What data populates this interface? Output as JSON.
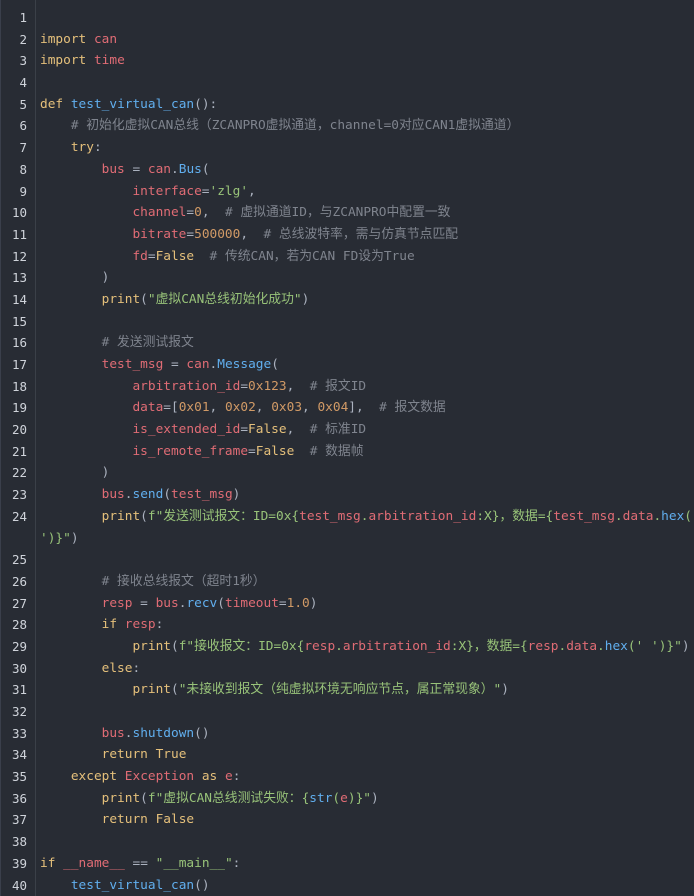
{
  "colors": {
    "background": "#282c34",
    "keyword": "#e5c07b",
    "function": "#61afef",
    "string": "#98c379",
    "number": "#d19a66",
    "identifier": "#e06c75",
    "comment": "#7f848e",
    "line_number": "#cfd3da"
  },
  "lines": [
    {
      "n": "1",
      "tokens": []
    },
    {
      "n": "2",
      "tokens": [
        {
          "t": "kw",
          "v": "import"
        },
        {
          "t": "plain",
          "v": " "
        },
        {
          "t": "id",
          "v": "can"
        }
      ]
    },
    {
      "n": "3",
      "tokens": [
        {
          "t": "kw",
          "v": "import"
        },
        {
          "t": "plain",
          "v": " "
        },
        {
          "t": "id",
          "v": "time"
        }
      ]
    },
    {
      "n": "4",
      "tokens": []
    },
    {
      "n": "5",
      "tokens": [
        {
          "t": "kw",
          "v": "def"
        },
        {
          "t": "plain",
          "v": " "
        },
        {
          "t": "fn",
          "v": "test_virtual_can"
        },
        {
          "t": "plain",
          "v": "():"
        }
      ]
    },
    {
      "n": "6",
      "tokens": [
        {
          "t": "plain",
          "v": "    "
        },
        {
          "t": "com",
          "v": "# 初始化虚拟CAN总线（ZCANPRO虚拟通道，channel=0对应CAN1虚拟通道）"
        }
      ]
    },
    {
      "n": "7",
      "tokens": [
        {
          "t": "plain",
          "v": "    "
        },
        {
          "t": "kw",
          "v": "try"
        },
        {
          "t": "plain",
          "v": ":"
        }
      ]
    },
    {
      "n": "8",
      "tokens": [
        {
          "t": "plain",
          "v": "        "
        },
        {
          "t": "id",
          "v": "bus"
        },
        {
          "t": "plain",
          "v": " = "
        },
        {
          "t": "id",
          "v": "can"
        },
        {
          "t": "plain",
          "v": "."
        },
        {
          "t": "fn",
          "v": "Bus"
        },
        {
          "t": "plain",
          "v": "("
        }
      ]
    },
    {
      "n": "9",
      "tokens": [
        {
          "t": "plain",
          "v": "            "
        },
        {
          "t": "id",
          "v": "interface"
        },
        {
          "t": "plain",
          "v": "="
        },
        {
          "t": "str",
          "v": "'zlg'"
        },
        {
          "t": "plain",
          "v": ","
        }
      ]
    },
    {
      "n": "10",
      "tokens": [
        {
          "t": "plain",
          "v": "            "
        },
        {
          "t": "id",
          "v": "channel"
        },
        {
          "t": "plain",
          "v": "="
        },
        {
          "t": "num",
          "v": "0"
        },
        {
          "t": "plain",
          "v": ",  "
        },
        {
          "t": "com",
          "v": "# 虚拟通道ID，与ZCANPRO中配置一致"
        }
      ]
    },
    {
      "n": "11",
      "tokens": [
        {
          "t": "plain",
          "v": "            "
        },
        {
          "t": "id",
          "v": "bitrate"
        },
        {
          "t": "plain",
          "v": "="
        },
        {
          "t": "num",
          "v": "500000"
        },
        {
          "t": "plain",
          "v": ",  "
        },
        {
          "t": "com",
          "v": "# 总线波特率，需与仿真节点匹配"
        }
      ]
    },
    {
      "n": "12",
      "tokens": [
        {
          "t": "plain",
          "v": "            "
        },
        {
          "t": "id",
          "v": "fd"
        },
        {
          "t": "plain",
          "v": "="
        },
        {
          "t": "kw",
          "v": "False"
        },
        {
          "t": "plain",
          "v": "  "
        },
        {
          "t": "com",
          "v": "# 传统CAN，若为CAN FD设为True"
        }
      ]
    },
    {
      "n": "13",
      "tokens": [
        {
          "t": "plain",
          "v": "        )"
        }
      ]
    },
    {
      "n": "14",
      "tokens": [
        {
          "t": "plain",
          "v": "        "
        },
        {
          "t": "kw",
          "v": "print"
        },
        {
          "t": "plain",
          "v": "("
        },
        {
          "t": "str",
          "v": "\"虚拟CAN总线初始化成功\""
        },
        {
          "t": "plain",
          "v": ")"
        }
      ]
    },
    {
      "n": "15",
      "tokens": []
    },
    {
      "n": "16",
      "tokens": [
        {
          "t": "plain",
          "v": "        "
        },
        {
          "t": "com",
          "v": "# 发送测试报文"
        }
      ]
    },
    {
      "n": "17",
      "tokens": [
        {
          "t": "plain",
          "v": "        "
        },
        {
          "t": "id",
          "v": "test_msg"
        },
        {
          "t": "plain",
          "v": " = "
        },
        {
          "t": "id",
          "v": "can"
        },
        {
          "t": "plain",
          "v": "."
        },
        {
          "t": "fn",
          "v": "Message"
        },
        {
          "t": "plain",
          "v": "("
        }
      ]
    },
    {
      "n": "18",
      "tokens": [
        {
          "t": "plain",
          "v": "            "
        },
        {
          "t": "id",
          "v": "arbitration_id"
        },
        {
          "t": "plain",
          "v": "="
        },
        {
          "t": "num",
          "v": "0x123"
        },
        {
          "t": "plain",
          "v": ",  "
        },
        {
          "t": "com",
          "v": "# 报文ID"
        }
      ]
    },
    {
      "n": "19",
      "tokens": [
        {
          "t": "plain",
          "v": "            "
        },
        {
          "t": "id",
          "v": "data"
        },
        {
          "t": "plain",
          "v": "=["
        },
        {
          "t": "num",
          "v": "0x01"
        },
        {
          "t": "plain",
          "v": ", "
        },
        {
          "t": "num",
          "v": "0x02"
        },
        {
          "t": "plain",
          "v": ", "
        },
        {
          "t": "num",
          "v": "0x03"
        },
        {
          "t": "plain",
          "v": ", "
        },
        {
          "t": "num",
          "v": "0x04"
        },
        {
          "t": "plain",
          "v": "],  "
        },
        {
          "t": "com",
          "v": "# 报文数据"
        }
      ]
    },
    {
      "n": "20",
      "tokens": [
        {
          "t": "plain",
          "v": "            "
        },
        {
          "t": "id",
          "v": "is_extended_id"
        },
        {
          "t": "plain",
          "v": "="
        },
        {
          "t": "kw",
          "v": "False"
        },
        {
          "t": "plain",
          "v": ",  "
        },
        {
          "t": "com",
          "v": "# 标准ID"
        }
      ]
    },
    {
      "n": "21",
      "tokens": [
        {
          "t": "plain",
          "v": "            "
        },
        {
          "t": "id",
          "v": "is_remote_frame"
        },
        {
          "t": "plain",
          "v": "="
        },
        {
          "t": "kw",
          "v": "False"
        },
        {
          "t": "plain",
          "v": "  "
        },
        {
          "t": "com",
          "v": "# 数据帧"
        }
      ]
    },
    {
      "n": "22",
      "tokens": [
        {
          "t": "plain",
          "v": "        )"
        }
      ]
    },
    {
      "n": "23",
      "tokens": [
        {
          "t": "plain",
          "v": "        "
        },
        {
          "t": "id",
          "v": "bus"
        },
        {
          "t": "plain",
          "v": "."
        },
        {
          "t": "fn",
          "v": "send"
        },
        {
          "t": "plain",
          "v": "("
        },
        {
          "t": "id",
          "v": "test_msg"
        },
        {
          "t": "plain",
          "v": ")"
        }
      ]
    },
    {
      "n": "24",
      "tokens": [
        {
          "t": "plain",
          "v": "        "
        },
        {
          "t": "kw",
          "v": "print"
        },
        {
          "t": "plain",
          "v": "("
        },
        {
          "t": "str",
          "v": "f\"发送测试报文：ID=0x{"
        },
        {
          "t": "id",
          "v": "test_msg"
        },
        {
          "t": "str",
          "v": "."
        },
        {
          "t": "id",
          "v": "arbitration_id"
        },
        {
          "t": "str",
          "v": ":X}，数据={"
        },
        {
          "t": "id",
          "v": "test_msg"
        },
        {
          "t": "str",
          "v": "."
        },
        {
          "t": "id",
          "v": "data"
        },
        {
          "t": "str",
          "v": "."
        },
        {
          "t": "fn",
          "v": "hex"
        },
        {
          "t": "str",
          "v": "('"
        }
      ]
    },
    {
      "n": "",
      "tokens": [
        {
          "t": "str",
          "v": "')}\""
        },
        {
          "t": "plain",
          "v": ")"
        }
      ]
    },
    {
      "n": "25",
      "tokens": []
    },
    {
      "n": "26",
      "tokens": [
        {
          "t": "plain",
          "v": "        "
        },
        {
          "t": "com",
          "v": "# 接收总线报文（超时1秒）"
        }
      ]
    },
    {
      "n": "27",
      "tokens": [
        {
          "t": "plain",
          "v": "        "
        },
        {
          "t": "id",
          "v": "resp"
        },
        {
          "t": "plain",
          "v": " = "
        },
        {
          "t": "id",
          "v": "bus"
        },
        {
          "t": "plain",
          "v": "."
        },
        {
          "t": "fn",
          "v": "recv"
        },
        {
          "t": "plain",
          "v": "("
        },
        {
          "t": "id",
          "v": "timeout"
        },
        {
          "t": "plain",
          "v": "="
        },
        {
          "t": "num",
          "v": "1.0"
        },
        {
          "t": "plain",
          "v": ")"
        }
      ]
    },
    {
      "n": "28",
      "tokens": [
        {
          "t": "plain",
          "v": "        "
        },
        {
          "t": "kw",
          "v": "if"
        },
        {
          "t": "plain",
          "v": " "
        },
        {
          "t": "id",
          "v": "resp"
        },
        {
          "t": "plain",
          "v": ":"
        }
      ]
    },
    {
      "n": "29",
      "tokens": [
        {
          "t": "plain",
          "v": "            "
        },
        {
          "t": "kw",
          "v": "print"
        },
        {
          "t": "plain",
          "v": "("
        },
        {
          "t": "str",
          "v": "f\"接收报文：ID=0x{"
        },
        {
          "t": "id",
          "v": "resp"
        },
        {
          "t": "str",
          "v": "."
        },
        {
          "t": "id",
          "v": "arbitration_id"
        },
        {
          "t": "str",
          "v": ":X}，数据={"
        },
        {
          "t": "id",
          "v": "resp"
        },
        {
          "t": "str",
          "v": "."
        },
        {
          "t": "id",
          "v": "data"
        },
        {
          "t": "str",
          "v": "."
        },
        {
          "t": "fn",
          "v": "hex"
        },
        {
          "t": "str",
          "v": "(' ')}\""
        },
        {
          "t": "plain",
          "v": ")"
        }
      ]
    },
    {
      "n": "30",
      "tokens": [
        {
          "t": "plain",
          "v": "        "
        },
        {
          "t": "kw",
          "v": "else"
        },
        {
          "t": "plain",
          "v": ":"
        }
      ]
    },
    {
      "n": "31",
      "tokens": [
        {
          "t": "plain",
          "v": "            "
        },
        {
          "t": "kw",
          "v": "print"
        },
        {
          "t": "plain",
          "v": "("
        },
        {
          "t": "str",
          "v": "\"未接收到报文（纯虚拟环境无响应节点，属正常现象）\""
        },
        {
          "t": "plain",
          "v": ")"
        }
      ]
    },
    {
      "n": "32",
      "tokens": []
    },
    {
      "n": "33",
      "tokens": [
        {
          "t": "plain",
          "v": "        "
        },
        {
          "t": "id",
          "v": "bus"
        },
        {
          "t": "plain",
          "v": "."
        },
        {
          "t": "fn",
          "v": "shutdown"
        },
        {
          "t": "plain",
          "v": "()"
        }
      ]
    },
    {
      "n": "34",
      "tokens": [
        {
          "t": "plain",
          "v": "        "
        },
        {
          "t": "kw",
          "v": "return"
        },
        {
          "t": "plain",
          "v": " "
        },
        {
          "t": "kw",
          "v": "True"
        }
      ]
    },
    {
      "n": "35",
      "tokens": [
        {
          "t": "plain",
          "v": "    "
        },
        {
          "t": "kw",
          "v": "except"
        },
        {
          "t": "plain",
          "v": " "
        },
        {
          "t": "id",
          "v": "Exception"
        },
        {
          "t": "plain",
          "v": " "
        },
        {
          "t": "kw",
          "v": "as"
        },
        {
          "t": "plain",
          "v": " "
        },
        {
          "t": "id",
          "v": "e"
        },
        {
          "t": "plain",
          "v": ":"
        }
      ]
    },
    {
      "n": "36",
      "tokens": [
        {
          "t": "plain",
          "v": "        "
        },
        {
          "t": "kw",
          "v": "print"
        },
        {
          "t": "plain",
          "v": "("
        },
        {
          "t": "str",
          "v": "f\"虚拟CAN总线测试失败：{"
        },
        {
          "t": "fn",
          "v": "str"
        },
        {
          "t": "str",
          "v": "("
        },
        {
          "t": "id",
          "v": "e"
        },
        {
          "t": "str",
          "v": ")}\""
        },
        {
          "t": "plain",
          "v": ")"
        }
      ]
    },
    {
      "n": "37",
      "tokens": [
        {
          "t": "plain",
          "v": "        "
        },
        {
          "t": "kw",
          "v": "return"
        },
        {
          "t": "plain",
          "v": " "
        },
        {
          "t": "kw",
          "v": "False"
        }
      ]
    },
    {
      "n": "38",
      "tokens": []
    },
    {
      "n": "39",
      "tokens": [
        {
          "t": "kw",
          "v": "if"
        },
        {
          "t": "plain",
          "v": " "
        },
        {
          "t": "id",
          "v": "__name__"
        },
        {
          "t": "plain",
          "v": " == "
        },
        {
          "t": "str",
          "v": "\"__main__\""
        },
        {
          "t": "plain",
          "v": ":"
        }
      ]
    },
    {
      "n": "40",
      "tokens": [
        {
          "t": "plain",
          "v": "    "
        },
        {
          "t": "fn",
          "v": "test_virtual_can"
        },
        {
          "t": "plain",
          "v": "()"
        }
      ]
    }
  ]
}
